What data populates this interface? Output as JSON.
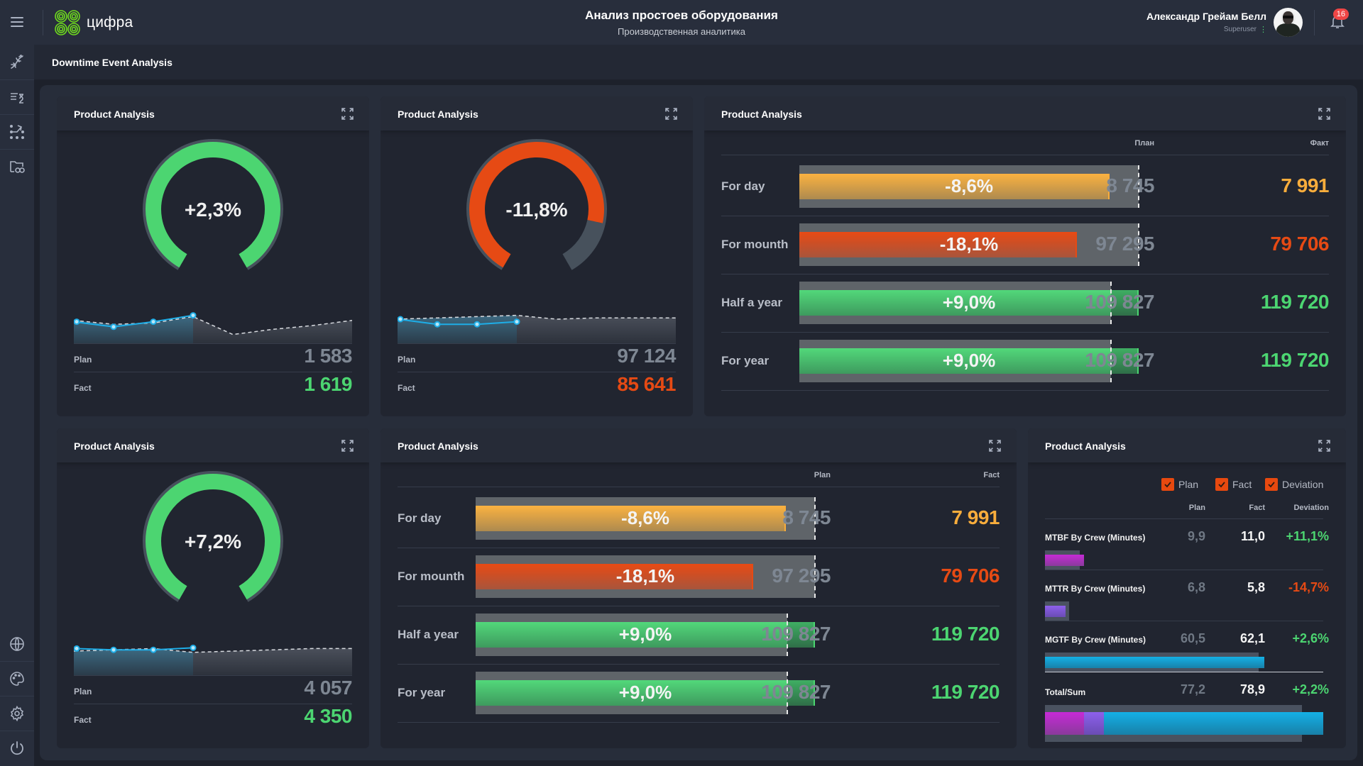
{
  "app": {
    "logo_text": "цифра",
    "title": "Анализ простоев оборудования",
    "subtitle": "Производственная аналитика"
  },
  "user": {
    "name": "Александр Грейам Белл",
    "role": "Superuser",
    "notifications": "16"
  },
  "sidebar": {
    "top_items": [
      {
        "icon": "dna-icon"
      },
      {
        "icon": "list-hourglass-icon"
      },
      {
        "icon": "workflow-icon"
      },
      {
        "icon": "folder-bicycle-icon"
      }
    ],
    "bottom_items": [
      {
        "icon": "globe-icon"
      },
      {
        "icon": "palette-icon"
      },
      {
        "icon": "gear-icon"
      },
      {
        "icon": "power-icon"
      }
    ]
  },
  "page": {
    "title": "Downtime Event Analysis"
  },
  "colors": {
    "green": "#4cd571",
    "red": "#e64a14",
    "orange": "#f8ad3c",
    "plan_gray": "#7e8793",
    "magenta": "#c42ad4",
    "violet": "#8a5fe8",
    "cyan": "#14a8dc"
  },
  "gauges": [
    {
      "title": "Product Analysis",
      "value_text": "+2,3%",
      "fill_fraction": 1.0,
      "status": "positive",
      "plan_label": "Plan",
      "plan_value": "1 583",
      "fact_label": "Fact",
      "fact_value": "1 619",
      "spark_plan": [
        0.7,
        0.55,
        0.6,
        0.85,
        0.15,
        0.35,
        0.5,
        0.7
      ],
      "spark_fact": [
        0.65,
        0.45,
        0.65,
        0.9
      ]
    },
    {
      "title": "Product Analysis",
      "value_text": "-11,8%",
      "fill_fraction": 0.84,
      "status": "negative",
      "plan_label": "Plan",
      "plan_value": "97 124",
      "fact_label": "Fact",
      "fact_value": "85 641",
      "spark_plan": [
        0.75,
        0.8,
        0.85,
        0.9,
        0.75,
        0.8,
        0.8,
        0.8
      ],
      "spark_fact": [
        0.75,
        0.55,
        0.55,
        0.65
      ]
    },
    {
      "title": "Product Analysis",
      "value_text": "+7,2%",
      "fill_fraction": 1.0,
      "status": "positive",
      "plan_label": "Plan",
      "plan_value": "4 057",
      "fact_label": "Fact",
      "fact_value": "4 350",
      "spark_plan": [
        0.75,
        0.8,
        0.85,
        0.7,
        0.75,
        0.8,
        0.85,
        0.85
      ],
      "spark_fact": [
        0.85,
        0.8,
        0.8,
        0.88
      ]
    }
  ],
  "bar_tables": [
    {
      "title": "Product Analysis",
      "col_plan": "План",
      "col_fact": "Факт",
      "rows": [
        {
          "label": "For day",
          "pct": "-8,6%",
          "fact_ratio": 0.914,
          "status": "warning",
          "plan": "8 745",
          "fact": "7 991"
        },
        {
          "label": "For mounth",
          "pct": "-18,1%",
          "fact_ratio": 0.819,
          "status": "negative",
          "plan": "97 295",
          "fact": "79 706"
        },
        {
          "label": "Half a year",
          "pct": "+9,0%",
          "fact_ratio": 1.09,
          "status": "positive",
          "plan": "109 827",
          "fact": "119 720"
        },
        {
          "label": "For year",
          "pct": "+9,0%",
          "fact_ratio": 1.09,
          "status": "positive",
          "plan": "109 827",
          "fact": "119 720"
        }
      ]
    },
    {
      "title": "Product Analysis",
      "col_plan": "Plan",
      "col_fact": "Fact",
      "rows": [
        {
          "label": "For day",
          "pct": "-8,6%",
          "fact_ratio": 0.914,
          "status": "warning",
          "plan": "8 745",
          "fact": "7 991"
        },
        {
          "label": "For mounth",
          "pct": "-18,1%",
          "fact_ratio": 0.819,
          "status": "negative",
          "plan": "97 295",
          "fact": "79 706"
        },
        {
          "label": "Half a year",
          "pct": "+9,0%",
          "fact_ratio": 1.09,
          "status": "positive",
          "plan": "109 827",
          "fact": "119 720"
        },
        {
          "label": "For year",
          "pct": "+9,0%",
          "fact_ratio": 1.09,
          "status": "positive",
          "plan": "109 827",
          "fact": "119 720"
        }
      ]
    }
  ],
  "crew": {
    "title": "Product Analysis",
    "checkboxes": [
      {
        "label": "Plan",
        "checked": true
      },
      {
        "label": "Fact",
        "checked": true
      },
      {
        "label": "Deviation",
        "checked": true
      }
    ],
    "columns": [
      "Plan",
      "Fact",
      "Deviation"
    ],
    "rows": [
      {
        "label": "MTBF By Crew (Minutes)",
        "plan": "9,9",
        "fact": "11,0",
        "deviation": "+11,1%",
        "status": "positive",
        "plan_num": 9.9,
        "fact_num": 11.0,
        "color": "magenta"
      },
      {
        "label": "MTTR By Crew (Minutes)",
        "plan": "6,8",
        "fact": "5,8",
        "deviation": "-14,7%",
        "status": "negative",
        "plan_num": 6.8,
        "fact_num": 5.8,
        "color": "violet"
      },
      {
        "label": "MGTF By Crew (Minutes)",
        "plan": "60,5",
        "fact": "62,1",
        "deviation": "+2,6%",
        "status": "positive",
        "plan_num": 60.5,
        "fact_num": 62.1,
        "color": "cyan"
      }
    ],
    "total": {
      "label": "Total/Sum",
      "plan": "77,2",
      "fact": "78,9",
      "deviation": "+2,2%",
      "status": "positive",
      "plan_num": 77.2,
      "fact_num": 78.9
    }
  }
}
